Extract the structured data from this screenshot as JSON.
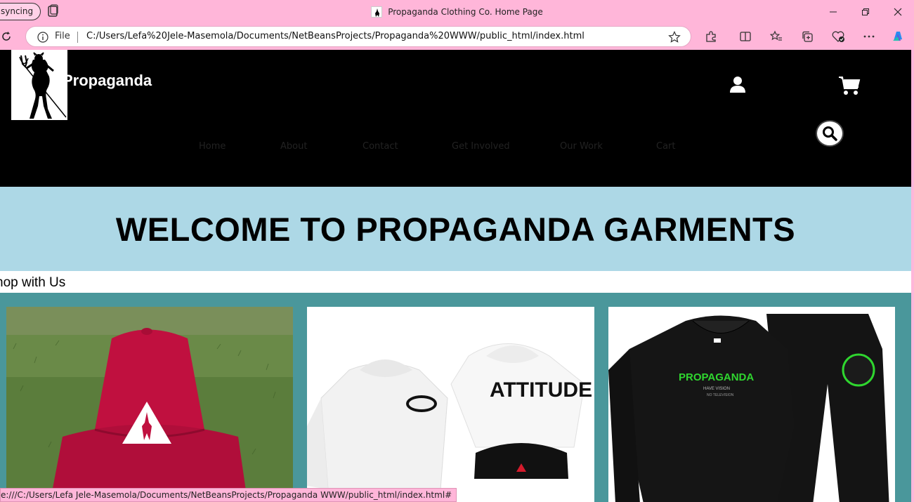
{
  "browser": {
    "sync_label": "syncing",
    "tab_title": "Propaganda Clothing Co. Home Page",
    "address_scheme": "File",
    "url": "C:/Users/Lefa%20Jele-Masemola/Documents/NetBeansProjects/Propaganda%20WWW/public_html/index.html",
    "status_url": "e:///C:/Users/Lefa Jele-Masemola/Documents/NetBeansProjects/Propaganda WWW/public_html/index.html#"
  },
  "site": {
    "brand": "Propaganda",
    "nav": [
      "Home",
      "About",
      "Contact",
      "Get Involved",
      "Our Work",
      "Cart"
    ],
    "welcome": "WELCOME TO PROPAGANDA GARMENTS",
    "shop_label": "hop with Us"
  },
  "products": [
    {
      "icon": "red-bucket-hat-image"
    },
    {
      "icon": "white-hoodies-and-beanie-image",
      "text": "ATTITUDE"
    },
    {
      "icon": "black-tracksuit-image",
      "text": "PROPAGANDA",
      "sub": "HAVE VISION",
      "sub2": "NO TELEVISION"
    }
  ],
  "colors": {
    "browser_chrome": "#ffb6d9",
    "header_bg": "#000000",
    "welcome_bg": "#add8e6",
    "products_bg": "#4a979b",
    "hat_red": "#c0103f",
    "tracksuit_green": "#2fd62f"
  }
}
